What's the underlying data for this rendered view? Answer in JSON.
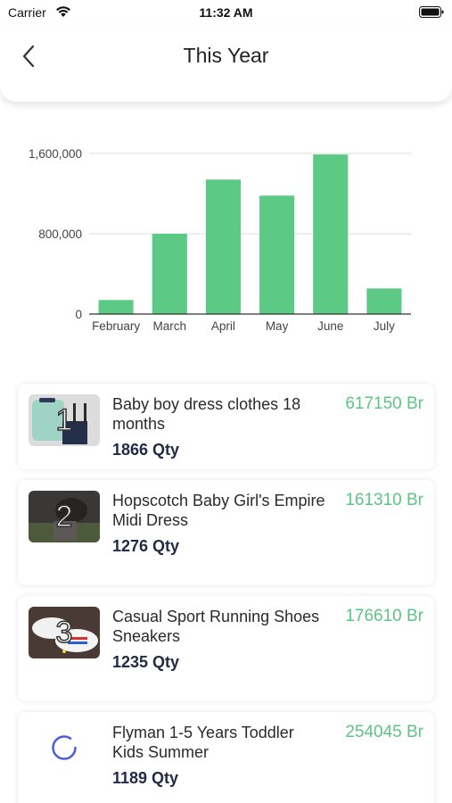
{
  "status_bar": {
    "carrier": "Carrier",
    "time": "11:32 AM",
    "icons": [
      "wifi-icon",
      "battery-icon"
    ]
  },
  "header": {
    "title": "This Year",
    "back_icon": "chevron-left-icon"
  },
  "colors": {
    "bar": "#5cc984",
    "price": "#5ec485",
    "qty": "#222b45",
    "spinner": "#4a5de0"
  },
  "chart_data": {
    "type": "bar",
    "categories": [
      "February",
      "March",
      "April",
      "May",
      "June",
      "July"
    ],
    "values": [
      140000,
      800000,
      1340000,
      1180000,
      1590000,
      255000
    ],
    "title": "",
    "xlabel": "",
    "ylabel": "",
    "ylim": [
      0,
      1600000
    ],
    "y_ticks": [
      "0",
      "800,000",
      "1,600,000"
    ],
    "y_tick_values": [
      0,
      800000,
      1600000
    ],
    "grid": true,
    "legend": "none"
  },
  "products": [
    {
      "rank": "1",
      "name": "Baby boy dress clothes 18 months",
      "qty": "1866 Qty",
      "price": "617150 Br",
      "thumb": "baby-dress-photo"
    },
    {
      "rank": "2",
      "name": "Hopscotch Baby Girl's Empire Midi Dress",
      "qty": "1276 Qty",
      "price": "161310 Br",
      "thumb": "midi-dress-photo"
    },
    {
      "rank": "3",
      "name": "Casual Sport Running Shoes Sneakers",
      "qty": "1235 Qty",
      "price": "176610 Br",
      "thumb": "sneakers-photo"
    },
    {
      "rank": "",
      "name": "Flyman 1-5 Years Toddler Kids Summer",
      "qty": "1189 Qty",
      "price": "254045 Br",
      "thumb": "loading-spinner"
    }
  ]
}
